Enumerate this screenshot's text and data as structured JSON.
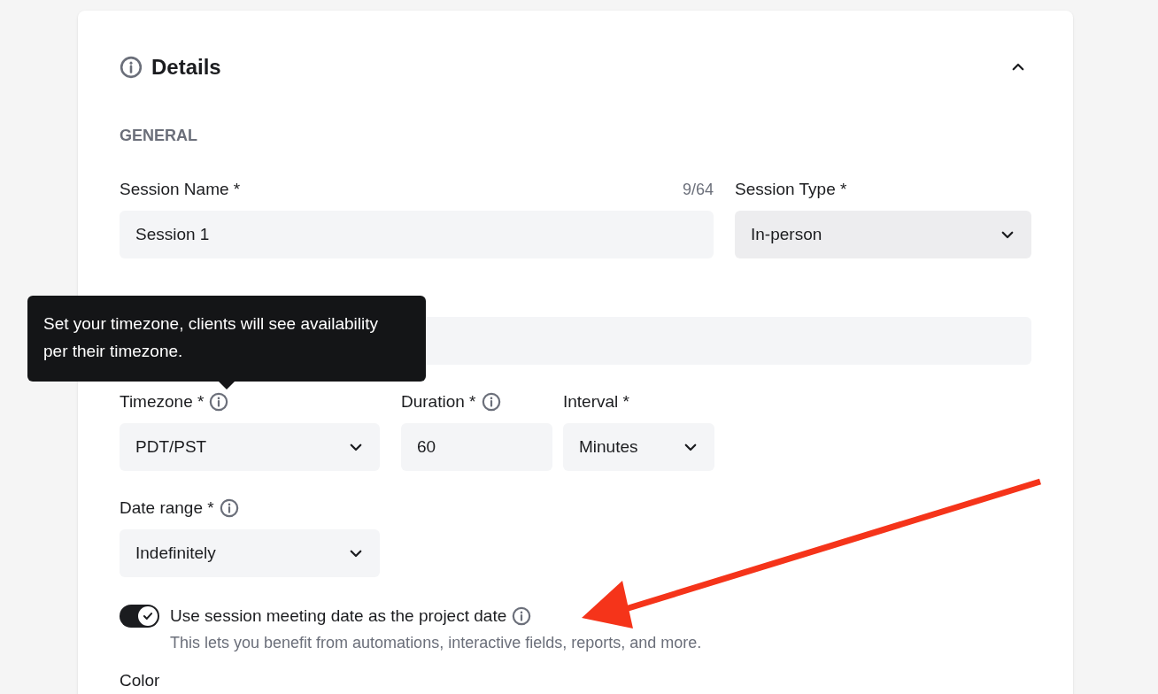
{
  "section": {
    "title": "Details",
    "expanded": true
  },
  "group_heading": "GENERAL",
  "rows": [
    {
      "fields": [
        {
          "label": "Session Name *",
          "kind": "text",
          "value": "Session 1",
          "counter": "9/64",
          "info": false
        },
        {
          "label": "Session Type *",
          "kind": "select",
          "value": "In-person",
          "info": false
        }
      ]
    },
    {
      "fields": [
        {
          "kind": "text",
          "info": false
        }
      ]
    },
    {
      "fields": [
        {
          "label": "Timezone *",
          "kind": "select",
          "value": "PDT/PST",
          "info": true
        },
        {
          "label": "Duration *",
          "kind": "text",
          "value": "60",
          "info": true
        },
        {
          "label": "Interval *",
          "kind": "select",
          "value": "Minutes",
          "info": false
        }
      ]
    },
    {
      "fields": [
        {
          "label": "Date range *",
          "kind": "select",
          "value": "Indefinitely",
          "info": true
        }
      ]
    }
  ],
  "toggle": {
    "on": true,
    "label": "Use session meeting date as the project date",
    "info": true,
    "description": "This lets you benefit from automations, interactive fields, reports, and more."
  },
  "next_label": "Color",
  "tooltip": {
    "text": "Set your timezone, clients will see availability per their timezone."
  }
}
